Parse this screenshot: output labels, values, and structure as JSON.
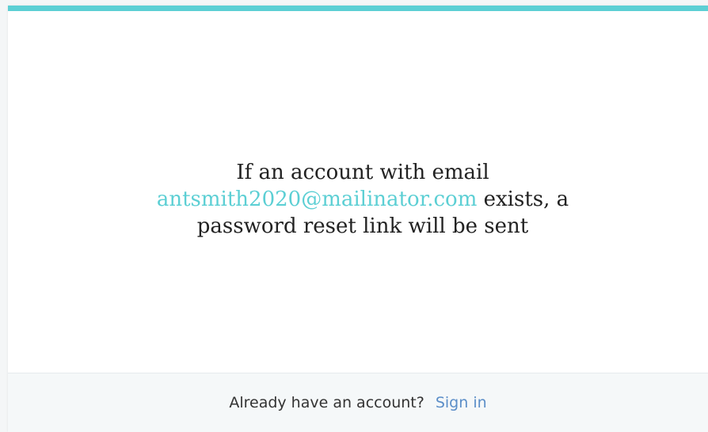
{
  "message": {
    "line1": "If an account with email",
    "email": "antsmith2020@mailinator.com",
    "line2_suffix": " exists, a",
    "line3": "password reset link will be sent"
  },
  "footer": {
    "prompt": "Already have an account?",
    "signin_label": "Sign in"
  },
  "colors": {
    "accent": "#5ccfd4",
    "link": "#5b8ec8"
  }
}
